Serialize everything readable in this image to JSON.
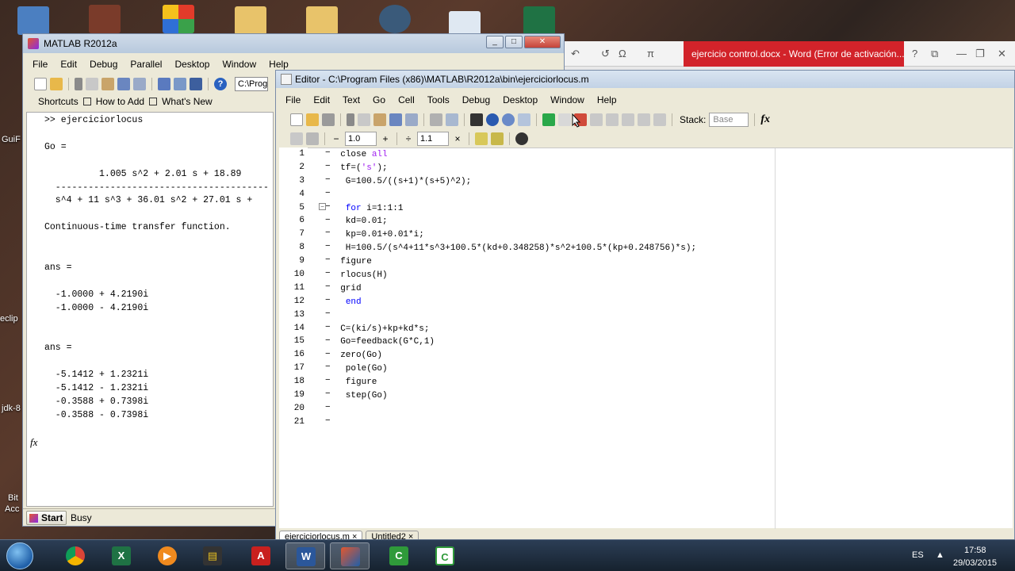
{
  "desktop": {
    "left_labels": [
      "GuiF",
      "eclip",
      "jdk-8",
      "Bit",
      "Acc"
    ],
    "colors": {
      "accent": "#d2232a"
    }
  },
  "word": {
    "title": "ejercicio control.docx - Word (Error de activación...",
    "ctrls": [
      "?",
      "⧉",
      "—",
      "❐",
      "✕"
    ],
    "qat": [
      "↶",
      "↺",
      "Ω",
      "π"
    ]
  },
  "matlab": {
    "title": "MATLAB R2012a",
    "menu": [
      "File",
      "Edit",
      "Debug",
      "Parallel",
      "Desktop",
      "Window",
      "Help"
    ],
    "current_folder": "C:\\Prog",
    "help_btn": "?",
    "shortcuts": [
      "Shortcuts",
      "How to Add",
      "What's New"
    ],
    "cmd_lines": [
      ">> ejerciciorlocus",
      "",
      "Go =",
      "",
      "          1.005 s^2 + 2.01 s + 18.89",
      "  ---------------------------------------",
      "  s^4 + 11 s^3 + 36.01 s^2 + 27.01 s +",
      "",
      "Continuous-time transfer function.",
      "",
      "",
      "ans =",
      "",
      "  -1.0000 + 4.2190i",
      "  -1.0000 - 4.2190i",
      "",
      "",
      "ans =",
      "",
      "  -5.1412 + 1.2321i",
      "  -5.1412 - 1.2321i",
      "  -0.3588 + 0.7398i",
      "  -0.3588 - 0.7398i"
    ],
    "fx": "fx",
    "start": "Start",
    "status": "Busy"
  },
  "editor": {
    "title": "Editor - C:\\Program Files (x86)\\MATLAB\\R2012a\\bin\\ejerciciorlocus.m",
    "menu": [
      "File",
      "Edit",
      "Text",
      "Go",
      "Cell",
      "Tools",
      "Debug",
      "Desktop",
      "Window",
      "Help"
    ],
    "stack_label": "Stack:",
    "stack_value": "Base",
    "fx": "fx",
    "cell_minus": "−",
    "cell_val1": "1.0",
    "cell_plus": "+",
    "cell_div": "÷",
    "cell_val2": "1.1",
    "cell_x": "×",
    "tabs": [
      "ejerciciorlocus.m",
      "Untitled2"
    ],
    "tab_close": "×",
    "line_numbers": [
      "1",
      "2",
      "3",
      "4",
      "5",
      "6",
      "7",
      "8",
      "9",
      "10",
      "11",
      "12",
      "13",
      "14",
      "15",
      "16",
      "17",
      "18",
      "19",
      "20",
      "21"
    ]
  },
  "taskbar": {
    "lang": "ES",
    "time": "17:58",
    "date": "29/03/2015"
  }
}
